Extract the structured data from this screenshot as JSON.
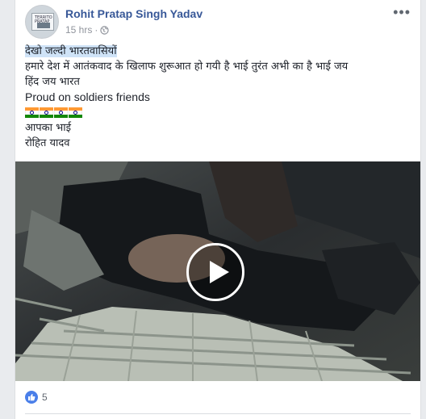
{
  "post": {
    "author": "Rohit Pratap Singh Yadav",
    "time": "15 hrs",
    "separator": "·",
    "privacy_icon": "globe-icon",
    "more_icon": "more-options-icon",
    "more_label": "•••",
    "avatar_text": "TERRITO PRATAP",
    "lines": {
      "l1": "देखो जल्दी भारतवासियों",
      "l2": "हमारे देश में आतंकवाद के खिलाफ शुरूआत हो गयी है भाई तुरंत अभी का है भाई जय",
      "l3": "हिंद जय भारत",
      "l4": "Proud on soldiers friends",
      "l5": "आपका भाई",
      "l6": "रोहित यादव"
    },
    "flags_count": 4
  },
  "video": {
    "play_icon": "play-icon"
  },
  "reactions": {
    "icon": "like-icon",
    "count": "5"
  },
  "colors": {
    "author": "#385898",
    "like": "#4a7fe9",
    "meta": "#90949c"
  }
}
